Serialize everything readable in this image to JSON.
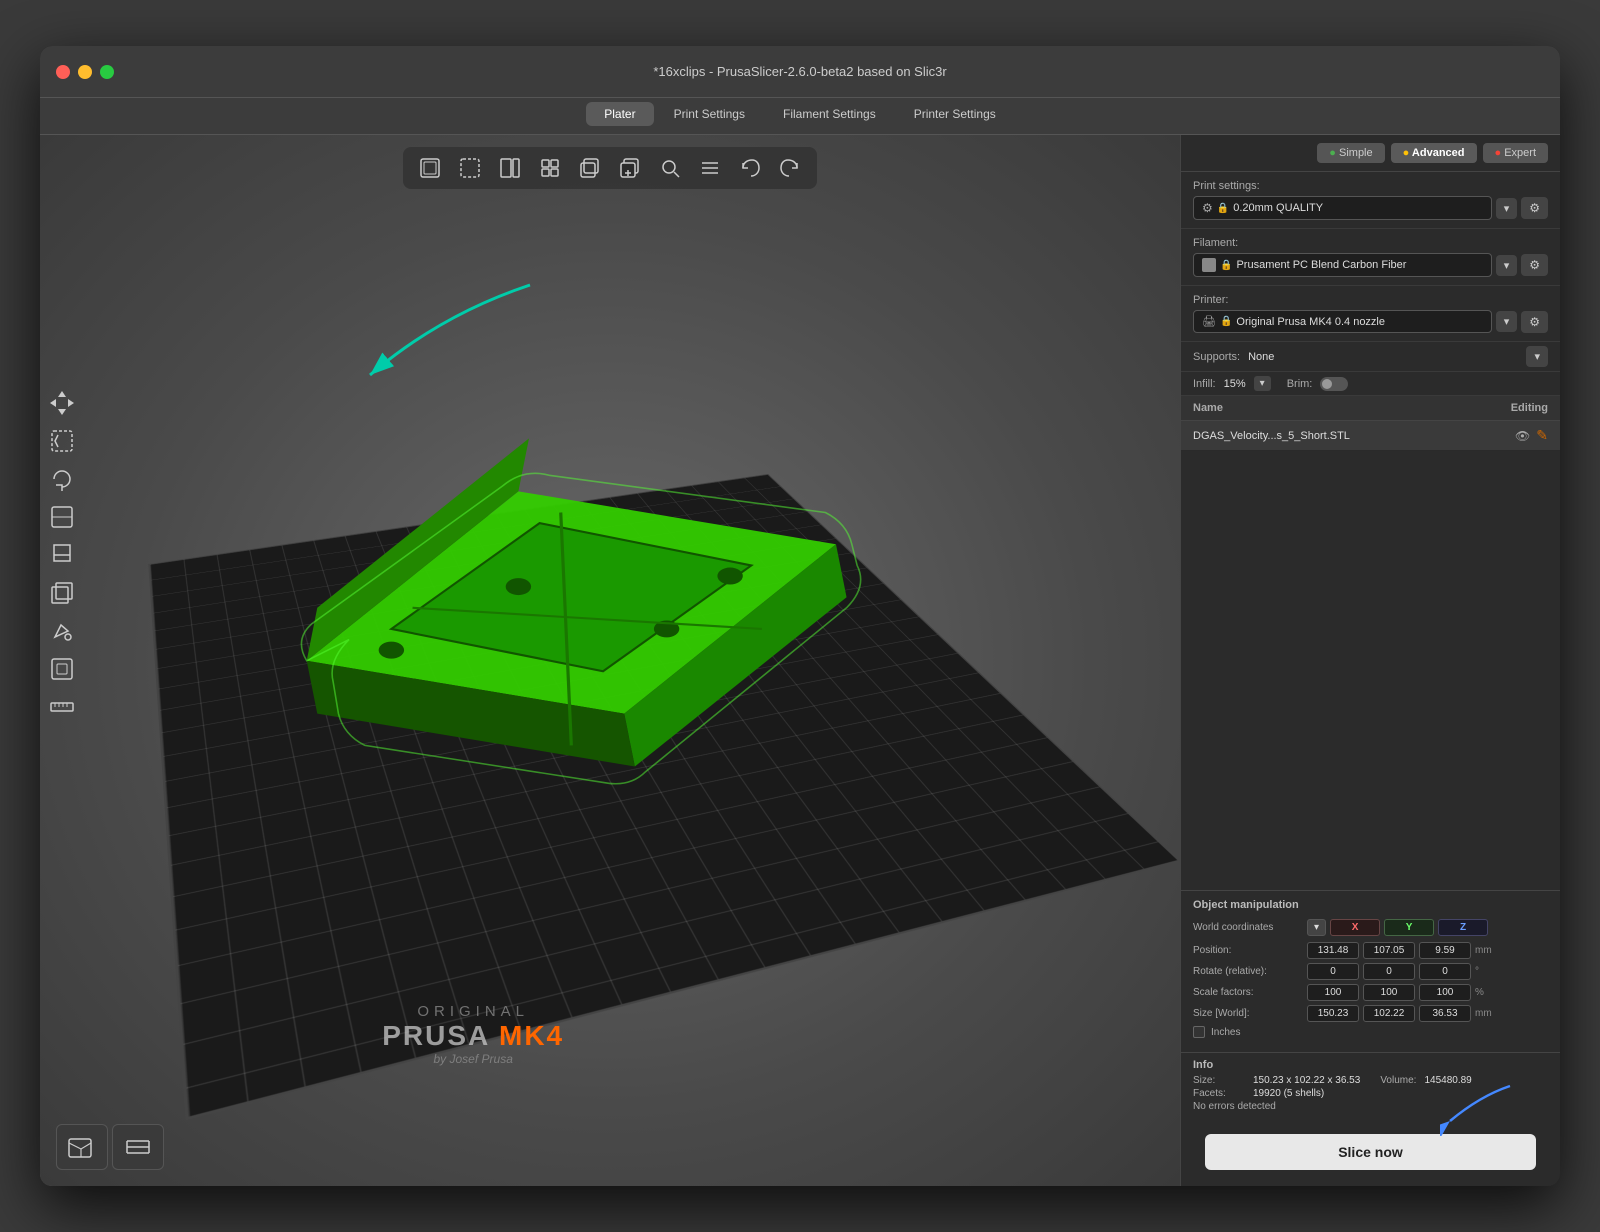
{
  "window": {
    "title": "*16xclips - PrusaSlicer-2.6.0-beta2 based on Slic3r"
  },
  "tabs": {
    "items": [
      "Plater",
      "Print Settings",
      "Filament Settings",
      "Printer Settings"
    ],
    "active": "Plater"
  },
  "complexity": {
    "simple_label": "Simple",
    "advanced_label": "Advanced",
    "expert_label": "Expert"
  },
  "print_settings": {
    "label": "Print settings:",
    "value": "0.20mm QUALITY"
  },
  "filament": {
    "label": "Filament:",
    "value": "Prusament PC Blend Carbon Fiber"
  },
  "printer": {
    "label": "Printer:",
    "value": "Original Prusa MK4 0.4 nozzle"
  },
  "supports": {
    "label": "Supports:",
    "value": "None"
  },
  "infill": {
    "label": "Infill:",
    "value": "15%"
  },
  "brim": {
    "label": "Brim:"
  },
  "object_list": {
    "col_name": "Name",
    "col_editing": "Editing",
    "items": [
      {
        "name": "DGAS_Velocity...s_5_Short.STL"
      }
    ]
  },
  "object_manipulation": {
    "title": "Object manipulation",
    "world_coords_label": "World coordinates",
    "axis_x": "X",
    "axis_y": "Y",
    "axis_z": "Z",
    "position_label": "Position:",
    "position_x": "131.48",
    "position_y": "107.05",
    "position_z": "9.59",
    "position_unit": "mm",
    "rotate_label": "Rotate (relative):",
    "rotate_x": "0",
    "rotate_y": "0",
    "rotate_z": "0",
    "rotate_unit": "°",
    "scale_label": "Scale factors:",
    "scale_x": "100",
    "scale_y": "100",
    "scale_z": "100",
    "scale_unit": "%",
    "size_label": "Size [World]:",
    "size_x": "150.23",
    "size_y": "102.22",
    "size_z": "36.53",
    "size_unit": "mm",
    "inches_label": "Inches"
  },
  "info": {
    "title": "Info",
    "size_label": "Size:",
    "size_value": "150.23 x 102.22 x 36.53",
    "volume_label": "Volume:",
    "volume_value": "145480.89",
    "facets_label": "Facets:",
    "facets_value": "19920 (5 shells)",
    "no_errors": "No errors detected"
  },
  "slice_btn": "Slice now",
  "toolbar": {
    "icons": [
      "⊞",
      "⊡",
      "⊟",
      "⊕",
      "⊗",
      "⊕",
      "⊙",
      "⊞",
      "≡",
      "↩",
      "➤"
    ]
  }
}
